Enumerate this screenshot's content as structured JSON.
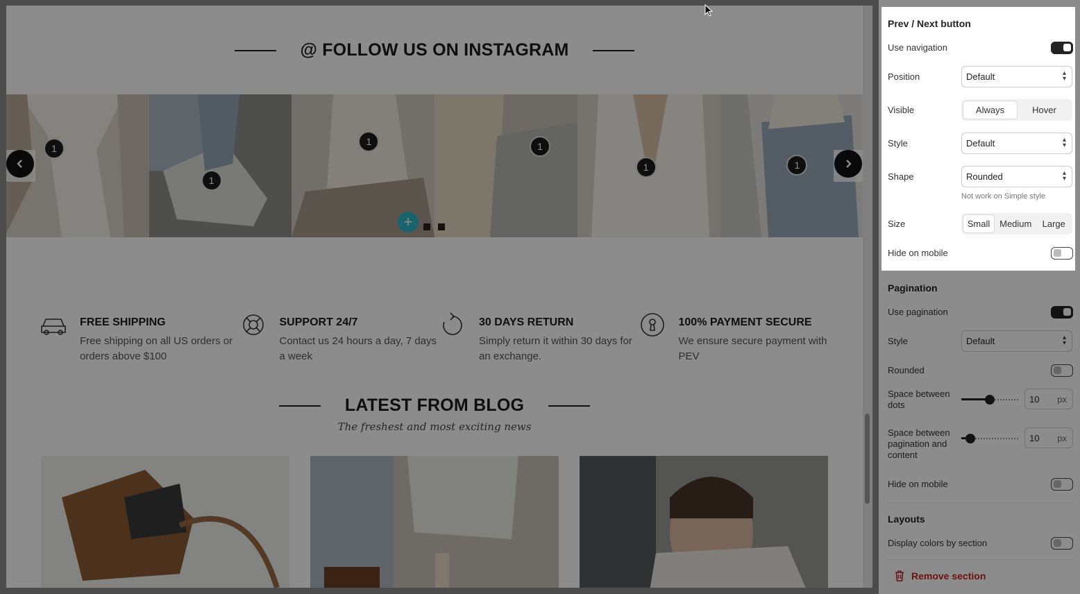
{
  "preview": {
    "instagram": {
      "heading": "@ FOLLOW US ON INSTAGRAM",
      "hotspot_label": "1",
      "prev_icon": "chevron-left-icon",
      "next_icon": "chevron-right-icon",
      "add_icon": "plus-icon"
    },
    "features": [
      {
        "icon": "car-icon",
        "title": "FREE SHIPPING",
        "text": "Free shipping on all US orders or orders above $100"
      },
      {
        "icon": "lifebuoy-icon",
        "title": "SUPPORT 24/7",
        "text": "Contact us 24 hours a day, 7 days a week"
      },
      {
        "icon": "refresh-icon",
        "title": "30 DAYS RETURN",
        "text": "Simply return it within 30 days for an exchange."
      },
      {
        "icon": "keyhole-icon",
        "title": "100% PAYMENT SECURE",
        "text": "We ensure secure payment with PEV"
      }
    ],
    "blog": {
      "heading": "LATEST FROM BLOG",
      "subtitle": "The freshest and most exciting news"
    }
  },
  "sidebar": {
    "prev_next": {
      "title": "Prev / Next button",
      "use_navigation_label": "Use navigation",
      "use_navigation_on": true,
      "position_label": "Position",
      "position_value": "Default",
      "visible_label": "Visible",
      "visible_options": [
        "Always",
        "Hover"
      ],
      "visible_selected": "Always",
      "style_label": "Style",
      "style_value": "Default",
      "shape_label": "Shape",
      "shape_value": "Rounded",
      "shape_note": "Not work on Simple style",
      "size_label": "Size",
      "size_options": [
        "Small",
        "Medium",
        "Large"
      ],
      "size_selected": "Small",
      "hide_mobile_label": "Hide on mobile",
      "hide_mobile_on": false
    },
    "pagination": {
      "title": "Pagination",
      "use_pagination_label": "Use pagination",
      "use_pagination_on": true,
      "style_label": "Style",
      "style_value": "Default",
      "rounded_label": "Rounded",
      "rounded_on": false,
      "space_dots_label": "Space between dots",
      "space_dots_value": "10",
      "space_content_label": "Space between pagination and content",
      "space_content_value": "10",
      "unit": "px",
      "hide_mobile_label": "Hide on mobile",
      "hide_mobile_on": false
    },
    "layouts": {
      "title": "Layouts",
      "display_colors_label": "Display colors by section",
      "display_colors_on": false
    },
    "remove_label": "Remove section",
    "remove_icon": "trash-icon"
  }
}
